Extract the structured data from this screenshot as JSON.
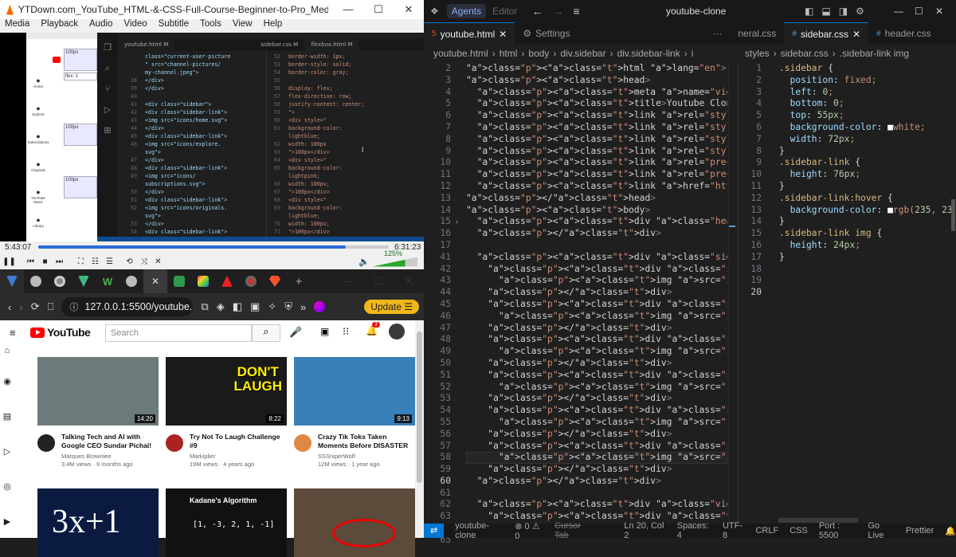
{
  "vlc": {
    "title": "YTDown.com_YouTube_HTML-&-CSS-Full-Course-Beginner-to-Pro_Media_G3e-cpL7ofc_002_7...",
    "menu": [
      "Media",
      "Playback",
      "Audio",
      "Video",
      "Subtitle",
      "Tools",
      "View",
      "Help"
    ],
    "time_elapsed": "5:43:07",
    "time_total": "6:31:23",
    "progress": 0.877,
    "volume": "125%",
    "volume_level": 0.72,
    "video": {
      "mini_tabs": [
        "youtube.html M",
        "sidebar.css M",
        "flexbox.html M"
      ],
      "mini_left_lines": [
        "class=\"current-user-picture",
        "\" src=\"channel-pictures/",
        "my-channel.jpeg\">",
        "</div>",
        "</div>",
        "",
        "<div class=\"sidebar\">",
        "<div class=\"sidebar-link\">",
        "<img src=\"icons/home.svg\">",
        "</div>",
        "<div class=\"sidebar-link\">",
        "<img src=\"icons/explore.",
        "svg\">",
        "</div>",
        "<div class=\"sidebar-link\">",
        "<img src=\"icons/",
        "subscriptions.svg\">",
        "</div>",
        "<div class=\"sidebar-link\">",
        "<img src=\"icons/originals.",
        "svg\">",
        "</div>",
        "<div class=\"sidebar-link\">"
      ],
      "mini_left_nums": [
        "",
        "",
        "",
        "38",
        "39",
        "40",
        "41",
        "42",
        "43",
        "44",
        "45",
        "46",
        "",
        "47",
        "48",
        "49",
        "",
        "50",
        "51",
        "52",
        "",
        "53",
        "54"
      ],
      "mini_right_lines": [
        "border-width: 1px;",
        "border-style: solid;",
        "border-color: gray;",
        "",
        "display: flex;",
        "flex-direction: row;",
        "justify-content: center;",
        "\">",
        "<div style=\"",
        "background-color:",
        "lightblue;",
        "width: 100px",
        "\">100px</div>",
        "<div style=\"",
        "background-color:",
        "lightpink;",
        "width: 100px;",
        "\">100px</div>",
        "<div style=\"",
        "background-color:",
        "lightblue;",
        "width: 100px;",
        "\">100px</div>"
      ],
      "mini_right_nums": [
        "52",
        "53",
        "54",
        "55",
        "56",
        "57",
        "58",
        "59",
        "60",
        "61",
        "",
        "62",
        "63",
        "64",
        "65",
        "",
        "66",
        "67",
        "68",
        "69",
        "",
        "70",
        "71"
      ],
      "mini_boxes": [
        "100px",
        "flex: 1",
        "100px",
        "100px"
      ],
      "mini_sidebar": [
        "Home",
        "Explore",
        "Subscriptions",
        "Originals",
        "YouTube Music",
        "Library"
      ]
    }
  },
  "browser": {
    "url": "127.0.0.1:5500/youtube.htm",
    "update_label": "Update",
    "search_placeholder": "Search",
    "notification_count": "3",
    "youtube_logo": "YouTube",
    "videos": [
      {
        "title": "Talking Tech and AI with Google CEO Sundar Pichai!",
        "channel": "Marques Brownlee",
        "stats": "3.4M views · 6 months ago",
        "duration": "14:20",
        "thumb_color": "#6b7a7a"
      },
      {
        "title": "Try Not To Laugh Challenge #9",
        "channel": "Markiplier",
        "stats": "19M views · 4 years ago",
        "duration": "8:22",
        "thumb_color": "#1a1a1a",
        "thumb_text": "DON'T\nLAUGH"
      },
      {
        "title": "Crazy Tik Toks Taken Moments Before DISASTER",
        "channel": "SSSniperWolf",
        "stats": "12M views · 1 year ago",
        "duration": "9:13",
        "thumb_color": "#3a80b8"
      },
      {
        "thumb_color": "#0a1a40",
        "thumb_text": "3x+1"
      },
      {
        "thumb_color": "#111",
        "thumb_text": "Kadane's Algorithm",
        "thumb_sub": "[1, -3, 2, 1, -1]"
      },
      {
        "thumb_color": "#5c4a3a"
      }
    ]
  },
  "vscode": {
    "title": "youtube-clone",
    "agents_label": "Agents",
    "editor_label": "Editor",
    "tabs": [
      {
        "label": "youtube.html",
        "active": true,
        "color": "#e44d26"
      },
      {
        "label": "Settings",
        "active": false,
        "color": "#999"
      },
      {
        "label": "neral.css",
        "active": false,
        "color": "#569cd6"
      },
      {
        "label": "sidebar.css",
        "active": true,
        "color": "#569cd6"
      },
      {
        "label": "header.css",
        "active": false,
        "color": "#569cd6"
      }
    ],
    "crumb_left": [
      "youtube.html",
      "html",
      "body",
      "div.sidebar",
      "div.sidebar-link",
      "i"
    ],
    "crumb_right": [
      "styles",
      "sidebar.css",
      ".sidebar-link img"
    ],
    "html_line_numbers": [
      "2",
      "3",
      "4",
      "5",
      "6",
      "7",
      "8",
      "9",
      "10",
      "11",
      "12",
      "13",
      "14",
      "15",
      "16",
      "17",
      "41",
      "42",
      "43",
      "44",
      "45",
      "46",
      "47",
      "48",
      "49",
      "50",
      "51",
      "52",
      "53",
      "54",
      "55",
      "56",
      "57",
      "58",
      "59",
      "60",
      "61",
      "62",
      "63",
      "64",
      "65"
    ],
    "html_lines": [
      "<html lang=\"en\">",
      "<head>",
      "  <meta name=\"viewport\" content=\"width=device-width,",
      "  <title>Youtube Clone</title>",
      "  <link rel=\"stylesheet\" href=\"styles/video.css\">",
      "  <link rel=\"stylesheet\" href=\"styles/header.css\">",
      "  <link rel=\"stylesheet\" href=\"styles/general.css\">",
      "  <link rel=\"stylesheet\" href=\"styles/sidebar.css\">",
      "  <link rel=\"preconnect\" href=\"https://fonts.googleap",
      "  <link rel=\"preconnect\" href=\"https://fonts.gstatic",
      "  <link href=\"https://fonts.googleapis.com/css2?fami",
      "</head>",
      "<body>",
      "  <div class=\"header\">···",
      "  </div>",
      "",
      "  <div class=\"sidebar\">",
      "    <div class=\"sidebar-link\">",
      "      <img src=\"images/icons/home.svg\" alt=\"\">",
      "    </div>",
      "    <div class=\"sidebar-link\">",
      "      <img src=\"images/icons/explore.svg\" alt=\"\">",
      "    </div>",
      "    <div class=\"sidebar-link\">",
      "      <img src=\"images/icons/subscriptions.svg\" a",
      "    </div>",
      "    <div class=\"sidebar-link\">",
      "      <img src=\"images/icons/originals.svg\" alt=\"",
      "    </div>",
      "    <div class=\"sidebar-link\">",
      "      <img src=\"images/icons/youtube-music.svg\" a",
      "    </div>",
      "    <div class=\"sidebar-link\">",
      "      <img src=\"images/icons/library.svg\" alt=\"\">",
      "    </div>",
      "  </div>",
      "",
      "  <div class=\"video-grid\">",
      "    <div class=\"video-preview\">···"
    ],
    "css_line_numbers": [
      "1",
      "2",
      "3",
      "4",
      "5",
      "6",
      "7",
      "8",
      "9",
      "10",
      "11",
      "12",
      "13",
      "14",
      "15",
      "16",
      "17",
      "18",
      "19",
      "20"
    ],
    "css_lines": [
      ".sidebar {",
      "  position: fixed;",
      "  left: 0;",
      "  bottom: 0;",
      "  top: 55px;",
      "  background-color: ■white;",
      "  width: 72px;",
      "}",
      "",
      ".sidebar-link {",
      "  height: 76px;",
      "}",
      "",
      ".sidebar-link:hover {",
      "  background-color: ■rgb(235, 23",
      "}",
      "",
      ".sidebar-link img {",
      "  height: 24px;",
      "}"
    ],
    "status": {
      "branch": "youtube-clone",
      "problems": "⊗ 0 ⚠ 0",
      "cursor_tab": "Cursor Tab",
      "position": "Ln 20, Col 2",
      "spaces": "Spaces: 4",
      "encoding": "UTF-8",
      "eol": "CRLF",
      "language": "CSS",
      "port": "Port : 5500",
      "golive": "Go Live",
      "prettier": "Prettier"
    }
  }
}
